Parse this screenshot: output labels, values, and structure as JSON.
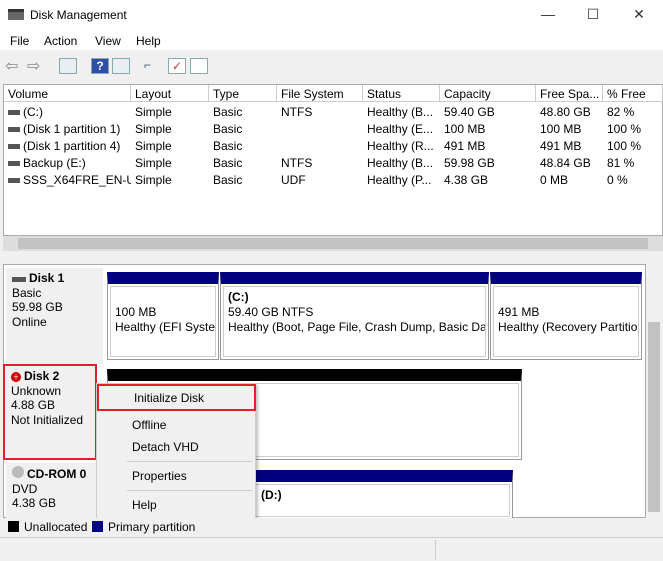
{
  "window": {
    "title": "Disk Management",
    "minimize": "—",
    "maximize": "☐",
    "close": "✕"
  },
  "menu": [
    "File",
    "Action",
    "View",
    "Help"
  ],
  "toolbar": [
    "back-icon",
    "forward-icon",
    "console-tree-icon",
    "help-icon",
    "action-pane-icon",
    "connect-icon",
    "check-icon",
    "properties-icon"
  ],
  "columns": [
    "Volume",
    "Layout",
    "Type",
    "File System",
    "Status",
    "Capacity",
    "Free Spa...",
    "% Free"
  ],
  "rows": [
    [
      "(C:)",
      "Simple",
      "Basic",
      "NTFS",
      "Healthy (B...",
      "59.40 GB",
      "48.80 GB",
      "82 %"
    ],
    [
      "(Disk 1 partition 1)",
      "Simple",
      "Basic",
      "",
      "Healthy (E...",
      "100 MB",
      "100 MB",
      "100 %"
    ],
    [
      "(Disk 1 partition 4)",
      "Simple",
      "Basic",
      "",
      "Healthy (R...",
      "491 MB",
      "491 MB",
      "100 %"
    ],
    [
      "Backup (E:)",
      "Simple",
      "Basic",
      "NTFS",
      "Healthy (B...",
      "59.98 GB",
      "48.84 GB",
      "81 %"
    ],
    [
      "SSS_X64FRE_EN-U...",
      "Simple",
      "Basic",
      "UDF",
      "Healthy (P...",
      "4.38 GB",
      "0 MB",
      "0 %"
    ]
  ],
  "disks": {
    "disk1": {
      "name": "Disk 1",
      "type": "Basic",
      "size": "59.98 GB",
      "state": "Online",
      "parts": [
        {
          "label": "",
          "size": "100 MB",
          "status": "Healthy (EFI System"
        },
        {
          "label": "(C:)",
          "size": "59.40 GB NTFS",
          "status": "Healthy (Boot, Page File, Crash Dump, Basic Dat"
        },
        {
          "label": "",
          "size": "491 MB",
          "status": "Healthy (Recovery Partitio"
        }
      ]
    },
    "disk2": {
      "name": "Disk 2",
      "type": "Unknown",
      "size": "4.88 GB",
      "state": "Not Initialized"
    },
    "cdrom": {
      "name": "CD-ROM 0",
      "type": "DVD",
      "size": "4.38 GB",
      "part": "(D:)"
    }
  },
  "context_menu": [
    "Initialize Disk",
    "Offline",
    "Detach VHD",
    "Properties",
    "Help"
  ],
  "legend": [
    {
      "label": "Unallocated",
      "color": "#000000"
    },
    {
      "label": "Primary partition",
      "color": "#000080"
    }
  ],
  "colors": {
    "primary": "#000080",
    "unallocated": "#000000",
    "highlight": "#e3202a"
  }
}
